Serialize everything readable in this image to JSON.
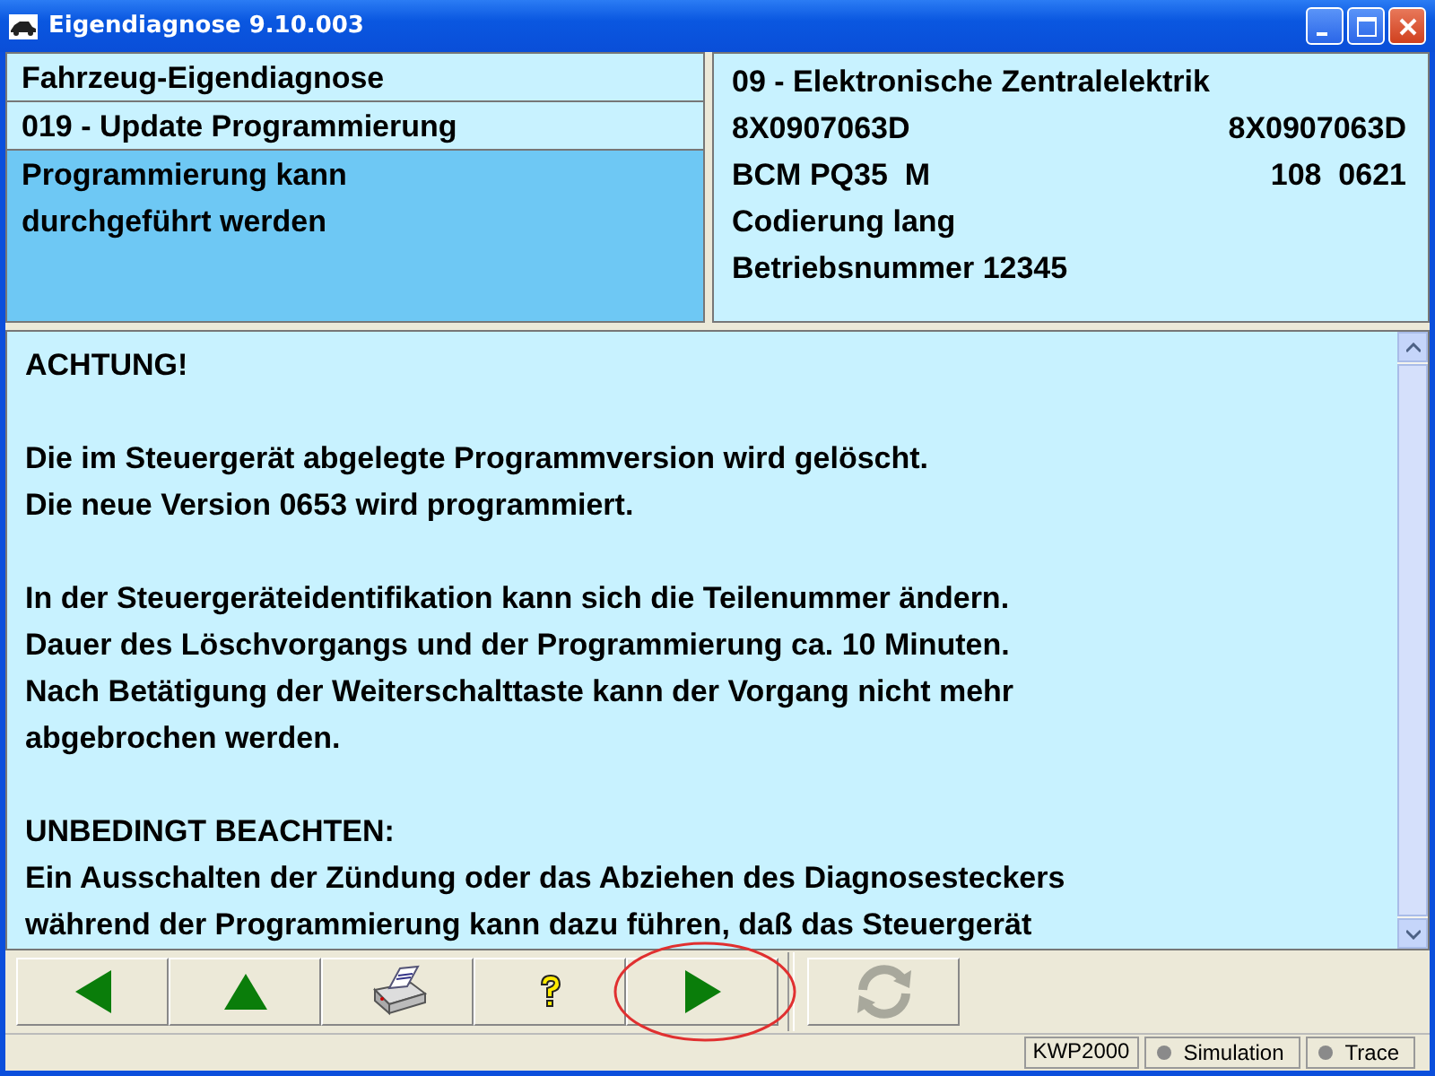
{
  "window": {
    "title": "Eigendiagnose 9.10.003"
  },
  "left_panel": {
    "items": [
      {
        "text": "Fahrzeug-Eigendiagnose",
        "selected": false
      },
      {
        "text": "019 - Update Programmierung",
        "selected": false
      },
      {
        "text": "Programmierung kann durchgeführt werden",
        "selected": true
      }
    ]
  },
  "right_panel": {
    "rows": [
      {
        "left": "09 - Elektronische Zentralelektrik"
      },
      {
        "left": "8X0907063D",
        "right": "8X0907063D"
      },
      {
        "left": "BCM PQ35  M",
        "right": "108  0621"
      },
      {
        "left": "Codierung lang"
      },
      {
        "left": "Betriebsnummer 12345"
      }
    ]
  },
  "message": {
    "paragraphs": [
      [
        "ACHTUNG!"
      ],
      [
        "Die im Steuergerät abgelegte Programmversion wird gelöscht.",
        "Die neue Version 0653 wird programmiert."
      ],
      [
        "In der Steuergeräteidentifikation kann sich die Teilenummer ändern.",
        "Dauer des Löschvorgangs und der Programmierung ca. 10 Minuten.",
        "Nach Betätigung der Weiterschalttaste kann der Vorgang nicht mehr",
        "abgebrochen werden."
      ],
      [
        "UNBEDINGT BEACHTEN:",
        "Ein Ausschalten der Zündung oder das Abziehen des Diagnosesteckers",
        "während der Programmierung kann dazu führen, daß das Steuergerät"
      ]
    ]
  },
  "toolbar": {
    "buttons": [
      {
        "kind": "back",
        "disabled": false,
        "circled": false
      },
      {
        "kind": "up",
        "disabled": false,
        "circled": false
      },
      {
        "kind": "print",
        "disabled": false,
        "circled": false
      },
      {
        "kind": "help",
        "disabled": false,
        "circled": false
      },
      {
        "kind": "next",
        "disabled": false,
        "circled": true
      },
      {
        "kind": "refresh",
        "disabled": true,
        "circled": false
      }
    ]
  },
  "status_bar": {
    "items": [
      {
        "kind": "text",
        "label": "KWP2000"
      },
      {
        "kind": "indicator",
        "label": "Simulation"
      },
      {
        "kind": "indicator",
        "label": "Trace"
      }
    ]
  }
}
